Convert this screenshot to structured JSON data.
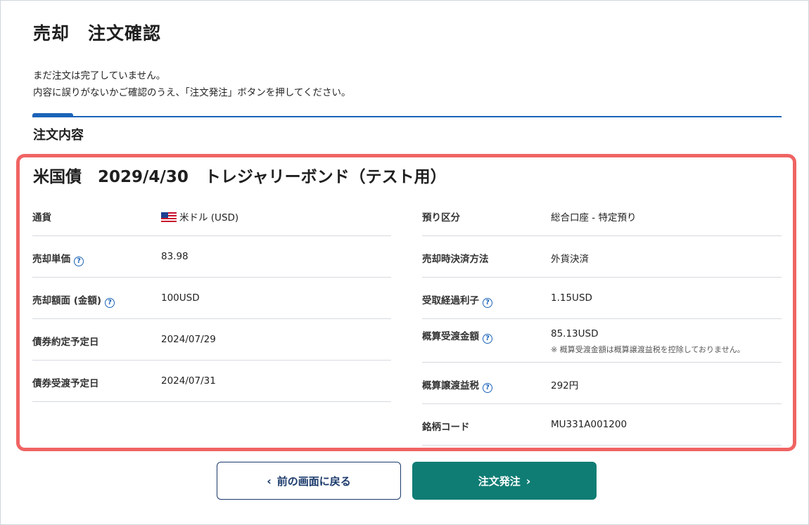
{
  "page": {
    "title": "売却　注文確認",
    "notice_line1": "まだ注文は完了していません。",
    "notice_line2": "内容に誤りがないかご確認のうえ、「注文発注」ボタンを押してください。",
    "section_title": "注文内容"
  },
  "bond": {
    "name": "米国債　2029/4/30　トレジャリーボンド（テスト用）"
  },
  "left_rows": [
    {
      "label": "通貨",
      "value": "米ドル (USD)"
    },
    {
      "label": "売却単価",
      "value": "83.98"
    },
    {
      "label": "売却額面 (金額)",
      "value": "100USD"
    },
    {
      "label": "債券約定予定日",
      "value": "2024/07/29"
    },
    {
      "label": "債券受渡予定日",
      "value": "2024/07/31"
    }
  ],
  "right_rows": [
    {
      "label": "預り区分",
      "value": "総合口座 - 特定預り"
    },
    {
      "label": "売却時決済方法",
      "value": "外貨決済"
    },
    {
      "label": "受取経過利子",
      "value": "1.15USD"
    },
    {
      "label": "概算受渡金額",
      "value": "85.13USD",
      "note": "※ 概算受渡金額は概算譲渡益税を控除しておりません。"
    },
    {
      "label": "概算譲渡益税",
      "value": "292円"
    },
    {
      "label": "銘柄コード",
      "value": "MU331A001200"
    }
  ],
  "help_icon": "?",
  "buttons": {
    "back_label": "前の画面に戻る",
    "submit_label": "注文発注"
  },
  "colors": {
    "accent": "#1b63b8",
    "highlight": "#f06464",
    "submit": "#0f7d74",
    "back_border": "#1b3a6b"
  }
}
